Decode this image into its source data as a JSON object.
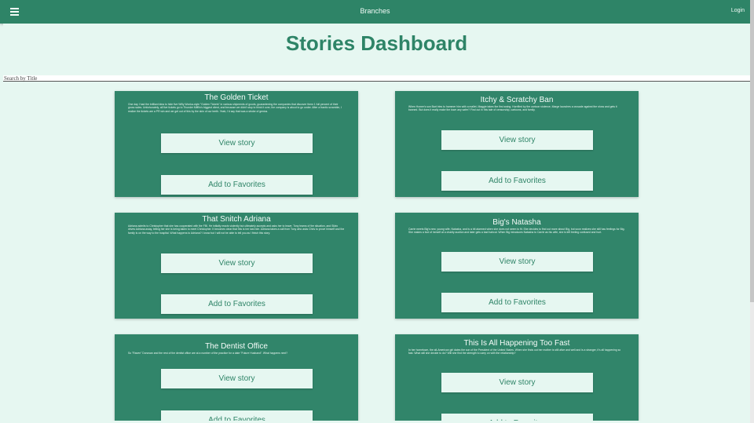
{
  "app": {
    "title": "Branches",
    "login_label": "Login",
    "menu_icon": "hamburger-menu-icon"
  },
  "page": {
    "heading": "Stories Dashboard"
  },
  "search": {
    "placeholder": "Search by Title",
    "value": ""
  },
  "stories": [
    {
      "title": "The Golden Ticket",
      "blurb": "One day I had the brilliant idea to hide five Willy Wonka-style \"Golden Tickets\" in various shipments of goods, guaranteeing the companies that discover them 1 full percent of their gross sales. Unfortunately, all five tickets go to Thunder Mifflin's biggest client, and because we didn't stop to think it over, the company is about to go under. After a frantic scramble, I realize the tickets are a PR win and we get out of this by the skin of our teeth. Yeah, I'd say that was a stroke of genius.",
      "view_label": "View story",
      "favorite_label": "Add to Favorites"
    },
    {
      "title": "Itchy & Scratchy Ban",
      "blurb": "When Homer's son Bart tries to hammer him with a mallet, Maggie takes the first swing. Horrified by the cartoon violence, Marge launches a crusade against the show and gets it banned. But does it really make the town any safer? Find out in this tale of censorship, cartoons, and family.",
      "view_label": "View story",
      "favorite_label": "Add to Favorites"
    },
    {
      "title": "That Snitch Adriana",
      "blurb": "Adriana admits to Christopher that she has cooperated with the FBI. He initially reacts violently but ultimately accepts and asks her to leave. Tony learns of the situation, and Silvio drives Adriana away, telling her she is being taken to meet Christopher. It becomes clear that this is her last ride. Adriana takes a call from Tony who asks Chris to prove himself and the family is on the way to the hospital. What happens to Adriana? I know but I will not be able to tell you as I finish this story.",
      "view_label": "View story",
      "favorite_label": "Add to Favorites"
    },
    {
      "title": "Big's Natasha",
      "blurb": "Carrie meets Big's new, young wife, Natasha, and is a bit alarmed when she does not seem to fit. She decides to find out more about Big, but soon realizes she still has feelings for Big. She makes a fool of herself at a charity auction and later gets a bad haircut. When Big introduces Natasha to Carrie as his wife, she is left feeling confused and hurt.",
      "view_label": "View story",
      "favorite_label": "Add to Favorites"
    },
    {
      "title": "The Dentist Office",
      "blurb": "So \"Raven\" Donovan and the rest of the dentist office are at a number of the practice for a date \"Future Husband\". What happens next?",
      "view_label": "View story",
      "favorite_label": "Add to Favorites"
    },
    {
      "title": "This Is All Happening Too Fast",
      "blurb": "In her hometown, the all-American girl dates the son of the President of the United States. When she finds out her mother is still alive and well and is a stranger, it's all happening so fast. What will she decide to do? Will she find the strength to carry on with the relationship?",
      "view_label": "View story",
      "favorite_label": "Add to Favorites"
    }
  ]
}
